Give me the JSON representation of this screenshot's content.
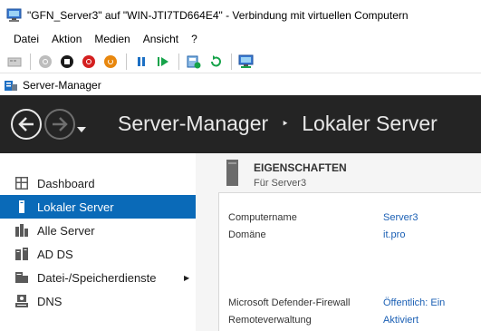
{
  "window": {
    "title": "\"GFN_Server3\" auf \"WIN-JTI7TD664E4\" - Verbindung mit virtuellen Computern"
  },
  "menu": [
    "Datei",
    "Aktion",
    "Medien",
    "Ansicht",
    "?"
  ],
  "toolbar": {
    "icons": [
      "ctrl-alt-del-icon",
      "start-icon",
      "turn-off-icon",
      "shutdown-icon",
      "power-icon",
      "pause-icon",
      "reset-icon",
      "checkpoint-icon",
      "revert-icon",
      "enhanced-session-icon"
    ]
  },
  "app": {
    "title": "Server-Manager"
  },
  "header": {
    "title": "Server-Manager",
    "separator": "‣",
    "subtitle": "Lokaler Server"
  },
  "sidebar": {
    "items": [
      {
        "label": "Dashboard",
        "icon": "dashboard-icon"
      },
      {
        "label": "Lokaler Server",
        "icon": "local-server-icon",
        "active": true
      },
      {
        "label": "Alle Server",
        "icon": "all-servers-icon"
      },
      {
        "label": "AD DS",
        "icon": "ad-ds-icon"
      },
      {
        "label": "Datei-/Speicherdienste",
        "icon": "file-storage-icon",
        "expand": "▶"
      },
      {
        "label": "DNS",
        "icon": "dns-icon"
      }
    ]
  },
  "properties": {
    "heading": "EIGENSCHAFTEN",
    "subheading": "Für Server3",
    "rows": [
      {
        "label": "Computername",
        "value": "Server3"
      },
      {
        "label": "Domäne",
        "value": "it.pro"
      },
      {
        "label": "Microsoft Defender-Firewall",
        "value": "Öffentlich: Ein"
      },
      {
        "label": "Remoteverwaltung",
        "value": "Aktiviert"
      }
    ]
  },
  "colors": {
    "accent": "#0a6ab8",
    "header_bg": "#242424",
    "link": "#1a5fb4"
  }
}
